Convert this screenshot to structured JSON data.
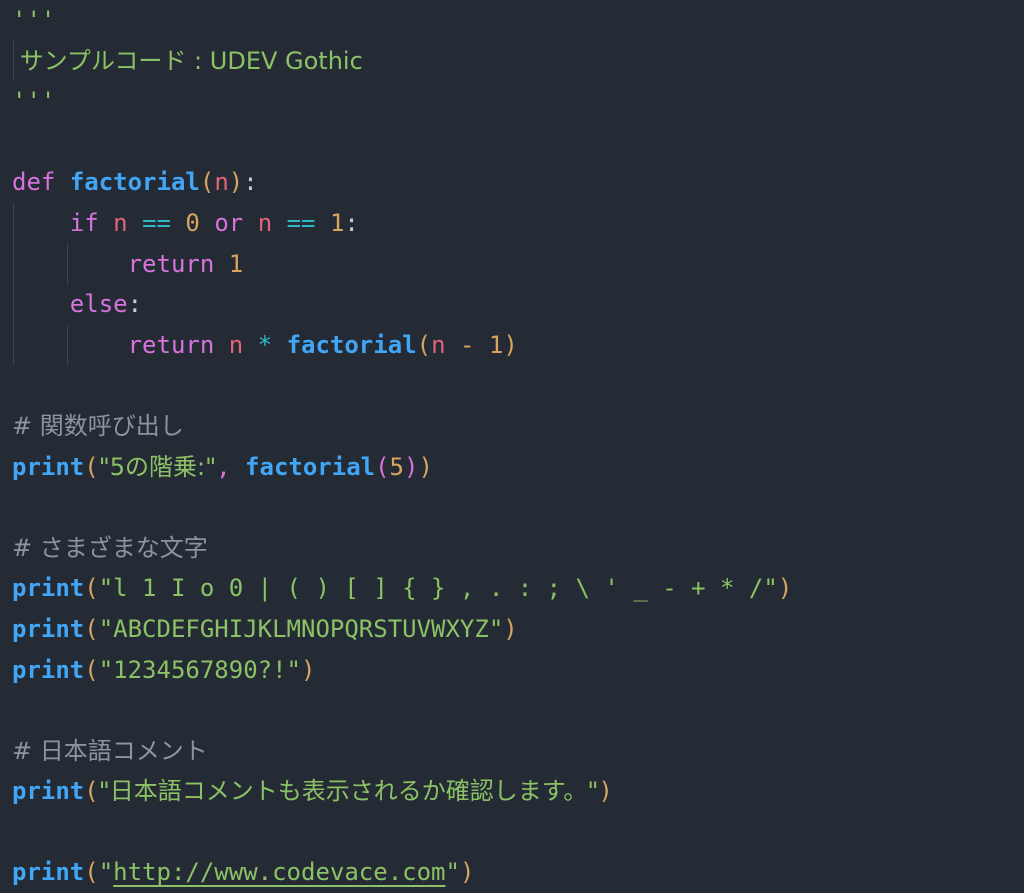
{
  "editor": {
    "language": "python",
    "theme_name": "dark",
    "background_color": "#242b35",
    "font_sample_name": "UDEV Gothic"
  },
  "colors": {
    "background": "#242b35",
    "keyword": "#d973dc",
    "function": "#41a6f6",
    "variable": "#e2637a",
    "operator": "#2bbac5",
    "number": "#d9a45f",
    "string": "#8cc265",
    "comment": "#8b94a1",
    "paren_level_1": "#d9a45f",
    "paren_level_2": "#d973dc",
    "indent_guide": "#3d4651"
  },
  "lines": {
    "l1_docquote_open": "'''",
    "l2_doc_text": " サンプルコード : UDEV Gothic",
    "l3_docquote_close": "'''",
    "l5_def_keyword": "def",
    "l5_def_name": "factorial",
    "l5_paren_open": "(",
    "l5_param": "n",
    "l5_paren_close": ")",
    "l5_colon": ":",
    "l6_if": "if",
    "l6_var_a": "n",
    "l6_eq_a": "==",
    "l6_num_a": "0",
    "l6_or": "or",
    "l6_var_b": "n",
    "l6_eq_b": "==",
    "l6_num_b": "1",
    "l6_colon": ":",
    "l7_return": "return",
    "l7_num": "1",
    "l8_else": "else",
    "l8_colon": ":",
    "l9_return": "return",
    "l9_var": "n",
    "l9_mul": "*",
    "l9_func": "factorial",
    "l9_paren_open": "(",
    "l9_var2": "n",
    "l9_minus": "-",
    "l9_num": "1",
    "l9_paren_close": ")",
    "l11_comment": "# 関数呼び出し",
    "l12_print": "print",
    "l12_paren_open": "(",
    "l12_string": "\"5の階乗:\"",
    "l12_comma": ",",
    "l12_func": "factorial",
    "l12_paren2_open": "(",
    "l12_num": "5",
    "l12_paren2_close": ")",
    "l12_paren_close": ")",
    "l14_comment": "# さまざまな文字",
    "l15_print": "print",
    "l15_paren_open": "(",
    "l15_string": "\"l 1 I o 0 | ( ) [ ] { } , . : ; \\ ' _ - + * /\"",
    "l15_paren_close": ")",
    "l16_print": "print",
    "l16_paren_open": "(",
    "l16_string": "\"ABCDEFGHIJKLMNOPQRSTUVWXYZ\"",
    "l16_paren_close": ")",
    "l17_print": "print",
    "l17_paren_open": "(",
    "l17_string": "\"1234567890?!\"",
    "l17_paren_close": ")",
    "l19_comment": "# 日本語コメント",
    "l20_print": "print",
    "l20_paren_open": "(",
    "l20_string": "\"日本語コメントも表示されるか確認します。\"",
    "l20_paren_close": ")",
    "l22_print": "print",
    "l22_paren_open": "(",
    "l22_quote_open": "\"",
    "l22_url": "http://www.codevace.com",
    "l22_quote_close": "\"",
    "l22_paren_close": ")"
  }
}
